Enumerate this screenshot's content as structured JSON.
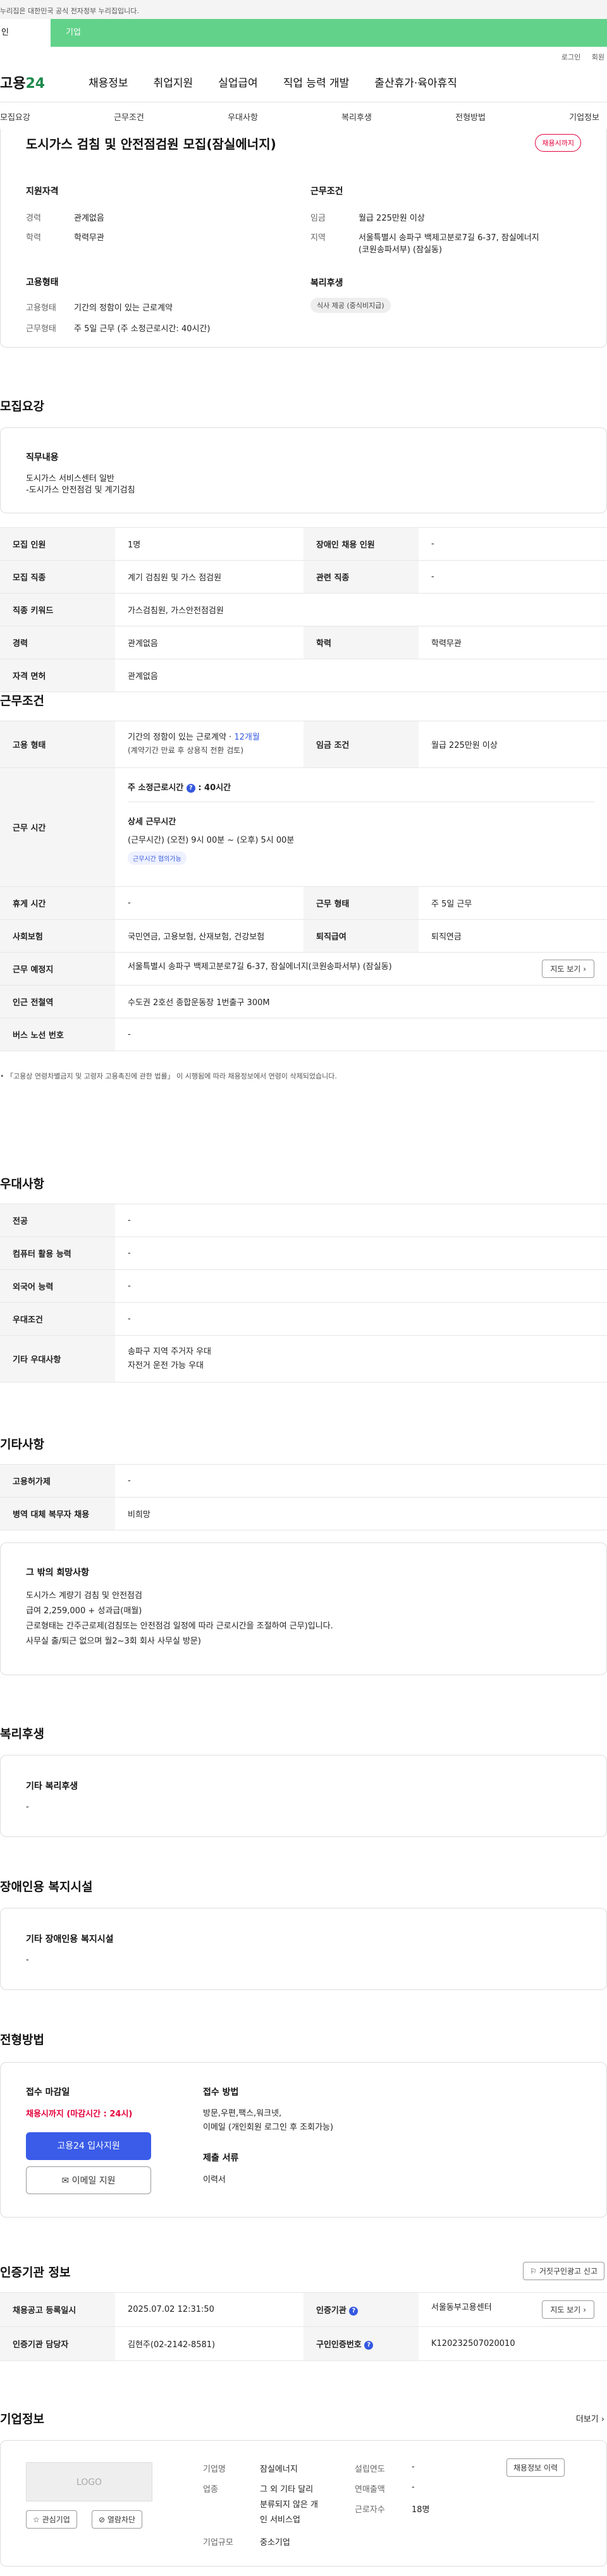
{
  "gov_banner": "누리집은 대한민국 공식 전자정부 누리집입니다.",
  "user_tabs": {
    "personal": "인",
    "business": "기업"
  },
  "util": {
    "login": "로그인",
    "join": "회원"
  },
  "logo": {
    "brand": "고용",
    "num": "24"
  },
  "gnb": [
    "채용정보",
    "취업지원",
    "실업급여",
    "직업 능력 개발",
    "출산휴가·육아휴직"
  ],
  "section_tabs": [
    "모집요강",
    "근무조건",
    "우대사항",
    "복리후생",
    "전형방법",
    "기업정보"
  ],
  "summary": {
    "title": "도시가스 검침 및 안전점검원 모집(잠실에너지)",
    "status": "채용시까지",
    "qual_heading": "지원자격",
    "career_k": "경력",
    "career_v": "관계없음",
    "edu_k": "학력",
    "edu_v": "학력무관",
    "emp_heading": "고용형태",
    "emptype_k": "고용형태",
    "emptype_v": "기간의 정함이 있는 근로계약",
    "worktype_k": "근무형태",
    "worktype_v": "주 5일 근무 (주 소정근로시간: 40시간)",
    "cond_heading": "근무조건",
    "wage_k": "임금",
    "wage_v": "월급 225만원 이상",
    "region_k": "지역",
    "region_v1": "서울특별시 송파구 백제고분로7길 6-37, 잠실에너지",
    "region_v2": "(코원송파서부) (잠실동)",
    "welfare_heading": "복리후생",
    "welfare_chip": "식사 제공 (중식비지급)"
  },
  "recruit": {
    "title": "모집요강",
    "duty_heading": "직무내용",
    "duty_line1": "도시가스 서비스센터 일반",
    "duty_line2": "-도시가스  안전점검 및 계기검침",
    "rows": {
      "headcount_k": "모집 인원",
      "headcount_v": "1명",
      "disabled_k": "장애인 채용 인원",
      "disabled_v": "-",
      "job_k": "모집 직종",
      "job_v": "계기 검침원 및 가스 점검원",
      "related_k": "관련 직종",
      "related_v": "-",
      "keyword_k": "직종 키워드",
      "keyword_v": "가스검침원, 가스안전점검원",
      "career_k": "경력",
      "career_v": "관계없음",
      "edu_k": "학력",
      "edu_v": "학력무관",
      "license_k": "자격 면허",
      "license_v": "관계없음"
    }
  },
  "work": {
    "title": "근무조건",
    "emp_k": "고용 형태",
    "emp_v1": "기간의 정함이 있는 근로계약 · ",
    "emp_v1_blue": "12개월",
    "emp_v2": "(계약기간 만료 후 상용직 전환 검토)",
    "wage_k": "임금 조건",
    "wage_v": "월급 225만원 이상",
    "hours_k": "근무 시간",
    "hours_v1": "주 소정근로시간",
    "hours_v1b": ": 40시간",
    "hours_detail_h": "상세 근무시간",
    "hours_detail": "(근무시간) (오전) 9시 00분 ~ (오후) 5시 00분",
    "hours_chip": "근무시간 협의가능",
    "break_k": "휴게 시간",
    "break_v": "-",
    "shift_k": "근무 형태",
    "shift_v": "주 5일 근무",
    "insurance_k": "사회보험",
    "insurance_v": "국민연금, 고용보험, 산재보험, 건강보험",
    "retire_k": "퇴직급여",
    "retire_v": "퇴직연금",
    "place_k": "근무 예정지",
    "place_v": "서울특별시 송파구 백제고분로7길 6-37, 잠실에너지(코원송파서부) (잠실동)",
    "map_btn": "지도 보기",
    "subway_k": "인근 전철역",
    "subway_v": "수도권 2호선 종합운동장 1번출구 300M",
    "bus_k": "버스 노선 번호",
    "bus_v": "-",
    "note": "「고용상 연령차별금지 및 고령자 고용촉진에 관한 법률」 이 시행됨에 따라 채용정보에서 연령이 삭제되었습니다."
  },
  "pref": {
    "title": "우대사항",
    "major_k": "전공",
    "major_v": "-",
    "computer_k": "컴퓨터 활용 능력",
    "computer_v": "-",
    "lang_k": "외국어 능력",
    "lang_v": "-",
    "cond_k": "우대조건",
    "cond_v": "-",
    "etc_k": "기타 우대사항",
    "etc_v1": "송파구 지역 주거자 우대",
    "etc_v2": "자전거 운전 가능  우대"
  },
  "other": {
    "title": "기타사항",
    "emp_k": "고용허가제",
    "emp_v": "-",
    "mil_k": "병역 대체 복무자 채용",
    "mil_v": "비희망",
    "extra_heading": "그 밖의 희망사항",
    "extra1": "도시가스 계량기 검침 및 안전점검",
    "extra2": "급여 2,259,000 + 성과급(매월)",
    "extra3": "근로형태는 간주근로제(검침또는 안전점검 일정에 따라 근로시간을 조절하여 근무)입니다.",
    "extra4": "사무실 출/퇴근 없으며  월2~3회 회사 사무실 방문)"
  },
  "welfare": {
    "title": "복리후생",
    "heading": "기타 복리후생",
    "value": "-"
  },
  "disabled_fac": {
    "title": "장애인용 복지시설",
    "heading": "기타 장애인용 복지시설",
    "value": "-"
  },
  "process": {
    "title": "전형방법",
    "deadline_h": "접수 마감일",
    "deadline_v": "채용시까지 (마감시간 : 24시)",
    "apply_btn": "고용24 입사지원",
    "email_btn": "이메일 지원",
    "method_h": "접수 방법",
    "method_v1": "방문,우편,팩스,워크넷,",
    "method_v2": "이메일 (개인회원 로그인 후 조회가능)",
    "docs_h": "제출 서류",
    "docs_v": "이력서"
  },
  "cert": {
    "title": "인증기관 정보",
    "report_btn": "거짓구인광고 신고",
    "reg_k": "채용공고 등록일시",
    "reg_v": "2025.07.02 12:31:50",
    "org_k": "인증기관",
    "org_v": "서울동부고용센터",
    "map_btn": "지도 보기",
    "staff_k": "인증기관 담당자",
    "staff_v": "김현주(02-2142-8581)",
    "num_k": "구인인증번호",
    "num_v": "K120232507020010"
  },
  "company": {
    "title": "기업정보",
    "more": "더보기",
    "logo": "LOGO",
    "fav_btn": "관심기업",
    "block_btn": "열람차단",
    "name_k": "기업명",
    "name_v": "잠실에너지",
    "founded_k": "설립연도",
    "founded_v": "-",
    "history_btn": "채용정보 이력",
    "biz_k": "업종",
    "biz_v1": "그 외 기타 달리",
    "biz_v2": "분류되지 않은 개",
    "biz_v3": "인 서비스업",
    "sales_k": "연매출액",
    "sales_v": "-",
    "staff_k": "근로자수",
    "staff_v": "18명",
    "size_k": "기업규모",
    "size_v": "중소기업"
  }
}
